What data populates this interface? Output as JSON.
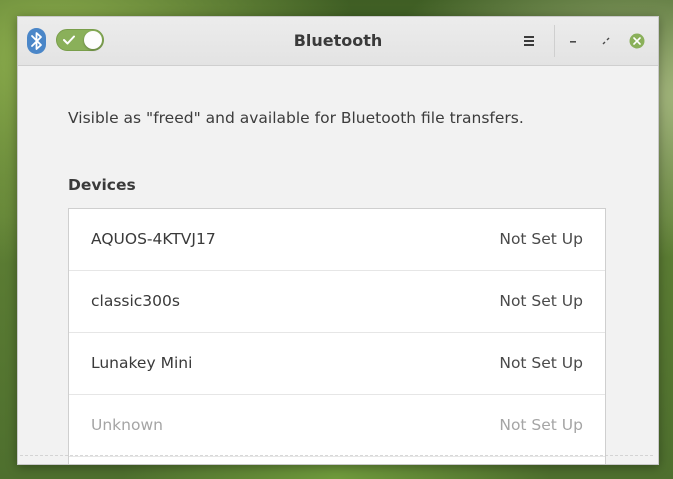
{
  "window": {
    "title": "Bluetooth"
  },
  "titlebar": {
    "app_icon": "bluetooth-icon",
    "toggle_state": "on",
    "menu_icon": "hamburger-menu-icon",
    "minimize_icon": "minimize-icon",
    "maximize_icon": "maximize-icon",
    "close_icon": "close-icon"
  },
  "main": {
    "status_text": "Visible as \"freed\" and available for Bluetooth file transfers.",
    "devices_heading": "Devices",
    "devices": [
      {
        "name": "AQUOS-4KTVJ17",
        "status": "Not Set Up",
        "dimmed": false
      },
      {
        "name": "classic300s",
        "status": "Not Set Up",
        "dimmed": false
      },
      {
        "name": "Lunakey Mini",
        "status": "Not Set Up",
        "dimmed": false
      },
      {
        "name": "Unknown",
        "status": "Not Set Up",
        "dimmed": true
      }
    ]
  },
  "colors": {
    "accent_toggle": "#8ab05a",
    "bluetooth_icon": "#4a86c8",
    "close_button": "#8ab05a"
  }
}
